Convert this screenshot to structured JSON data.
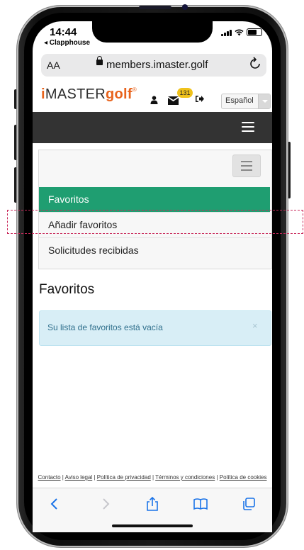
{
  "status_bar": {
    "time": "14:44",
    "back_app": "◂ Clapphouse"
  },
  "browser": {
    "text_size_label": "AA",
    "url": "members.imaster.golf",
    "reload_icon": "reload-icon"
  },
  "site_header": {
    "logo": {
      "i": "i",
      "master": "MASTER",
      "golf": "golf",
      "reg": "®"
    },
    "notification_count": "131",
    "language": "Español"
  },
  "menu": {
    "items": [
      {
        "label": "Favoritos",
        "active": true
      },
      {
        "label": "Añadir favoritos",
        "active": false
      },
      {
        "label": "Solicitudes recibidas",
        "active": false
      }
    ]
  },
  "main": {
    "heading": "Favoritos",
    "alert_text": "Su lista de favoritos está vacía",
    "alert_close": "×"
  },
  "footer": {
    "links": [
      "Contacto",
      "Aviso legal",
      "Política de privacidad",
      "Términos y condiciones",
      "Política de cookies"
    ],
    "separator": " | "
  },
  "colors": {
    "brand_orange": "#e8631c",
    "nav_dark": "#333333",
    "active_green": "#1f9e71",
    "alert_bg": "#d8eef6",
    "highlight": "#c9285a"
  }
}
